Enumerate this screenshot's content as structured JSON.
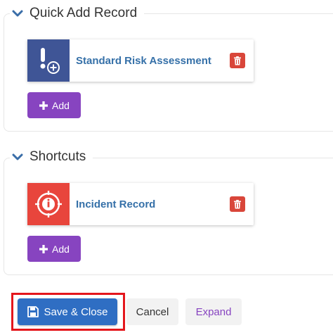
{
  "quick_add": {
    "title": "Quick Add Record",
    "items": [
      {
        "label": "Standard Risk Assessment",
        "icon": "risk-assessment-icon",
        "color": "#3f5596"
      }
    ],
    "add_label": "Add"
  },
  "shortcuts": {
    "title": "Shortcuts",
    "items": [
      {
        "label": "Incident Record",
        "icon": "incident-target-icon",
        "color": "#e8453c"
      }
    ],
    "add_label": "Add"
  },
  "footer": {
    "save_label": "Save & Close",
    "cancel_label": "Cancel",
    "expand_label": "Expand"
  },
  "colors": {
    "accent_purple": "#8744c0",
    "primary_blue": "#2f6ec3",
    "delete_red": "#d9463a",
    "highlight_red": "#e4161c",
    "link_blue": "#3570a8"
  }
}
